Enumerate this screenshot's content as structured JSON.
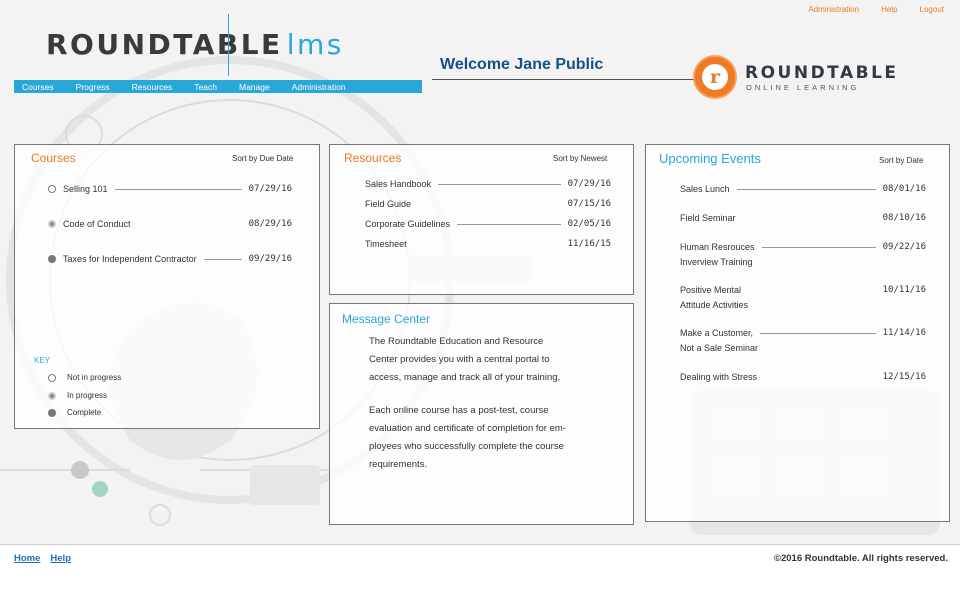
{
  "top_links": [
    "Administration",
    "Help",
    "Logout"
  ],
  "logo": {
    "main": "ROUNDTABLE",
    "suffix": "lms"
  },
  "welcome": "Welcome Jane Public",
  "brand": {
    "mark": "r",
    "name": "ROUNDTABLE",
    "sub": "ONLINE LEARNING"
  },
  "nav": [
    "Courses",
    "Progress",
    "Resources",
    "Teach",
    "Manage",
    "Administration"
  ],
  "courses": {
    "title": "Courses",
    "sort": "Sort by Due Date",
    "items": [
      {
        "name": "Selling 101",
        "date": "07/29/16",
        "status": "not-in-progress"
      },
      {
        "name": "Code of Conduct",
        "date": "08/29/16",
        "status": "in-progress"
      },
      {
        "name": "Taxes for Independent Contractor",
        "date": "09/29/16",
        "status": "complete"
      }
    ],
    "key": {
      "title": "KEY",
      "items": [
        "Not  in progress",
        "In progress",
        "Complete"
      ]
    }
  },
  "resources": {
    "title": "Resources",
    "sort": "Sort by Newest",
    "items": [
      {
        "name": "Sales Handbook",
        "date": "07/29/16"
      },
      {
        "name": "Field Guide",
        "date": "07/15/16"
      },
      {
        "name": "Corporate Guidelines",
        "date": "02/05/16"
      },
      {
        "name": "Timesheet",
        "date": "11/16/15"
      }
    ]
  },
  "message_center": {
    "title": "Message Center",
    "paragraph1": [
      "The Roundtable Education and Resource",
      "Center provides you with a central portal to",
      "access, manage and track all of your training,"
    ],
    "paragraph2": [
      "Each online course has a post-test, course",
      "evaluation and certificate of completion for em-",
      "ployees who successfully complete the course",
      "requirements."
    ]
  },
  "events": {
    "title": "Upcoming Events",
    "sort": "Sort by Date",
    "items": [
      {
        "line1": "Sales Lunch",
        "line2": "",
        "date": "08/01/16"
      },
      {
        "line1": "Field Seminar",
        "line2": "",
        "date": "08/10/16"
      },
      {
        "line1": "Human Resrouces",
        "line2": "Inverview Training",
        "date": "09/22/16"
      },
      {
        "line1": "Positive Mental",
        "line2": "Attitude Activities",
        "date": "10/11/16"
      },
      {
        "line1": "Make a Customer,",
        "line2": "Not a Sale Seminar",
        "date": "11/14/16"
      },
      {
        "line1": "Dealing with Stress",
        "line2": "",
        "date": "12/15/16"
      }
    ]
  },
  "footer": {
    "links": [
      "Home",
      "Help"
    ],
    "copyright": "©2016 Roundtable. All rights reserved."
  },
  "colors": {
    "accent_orange": "#ee7a23",
    "accent_blue": "#29a8d8",
    "title_blue": "#1a4e8a"
  }
}
